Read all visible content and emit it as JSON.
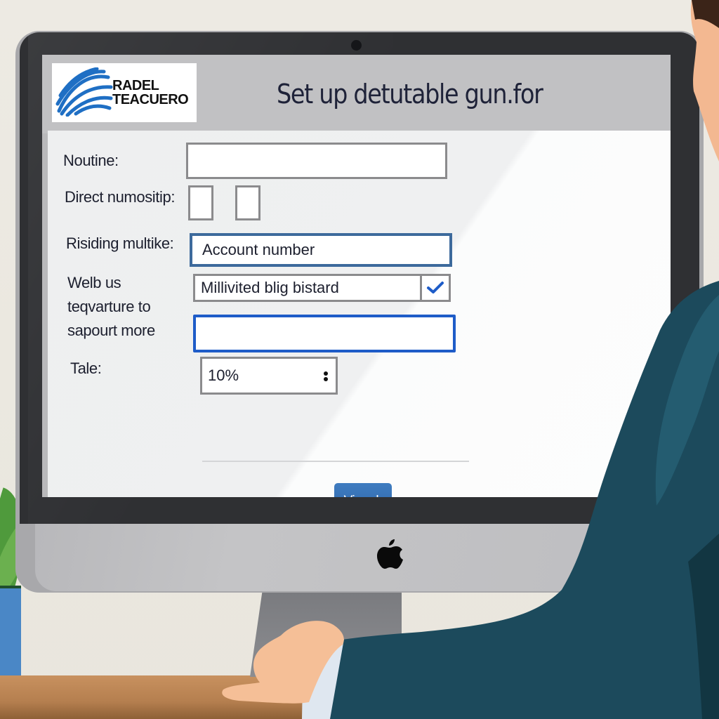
{
  "app": {
    "logo_line1": "RADEL",
    "logo_line2": "TEACUERO",
    "title": "Set up detutable gun.for"
  },
  "form": {
    "fields": [
      {
        "label": "Noutine:",
        "value": ""
      },
      {
        "label": "Direct numositip:",
        "value": ""
      },
      {
        "label": "Risiding multike:",
        "value": "Account number"
      },
      {
        "label_lines": [
          "Welb us",
          "teqvarture to",
          "sapourt more"
        ],
        "select_value": "Millivited blig bistard",
        "select_checked": true,
        "text_value": ""
      },
      {
        "label": "Tale:",
        "value": "10%"
      }
    ],
    "submit_label": "Viepek"
  },
  "icons": {
    "check": "checkmark-icon",
    "stepper": "stepper-icon",
    "device_logo": "apple-logo-icon",
    "brand": "wave-logo-icon"
  },
  "colors": {
    "accent_blue": "#1e5cc8",
    "button_blue": "#3370b4",
    "title_text": "#1e2238",
    "suit": "#1b4a5c",
    "bezel": "#2f3033"
  }
}
